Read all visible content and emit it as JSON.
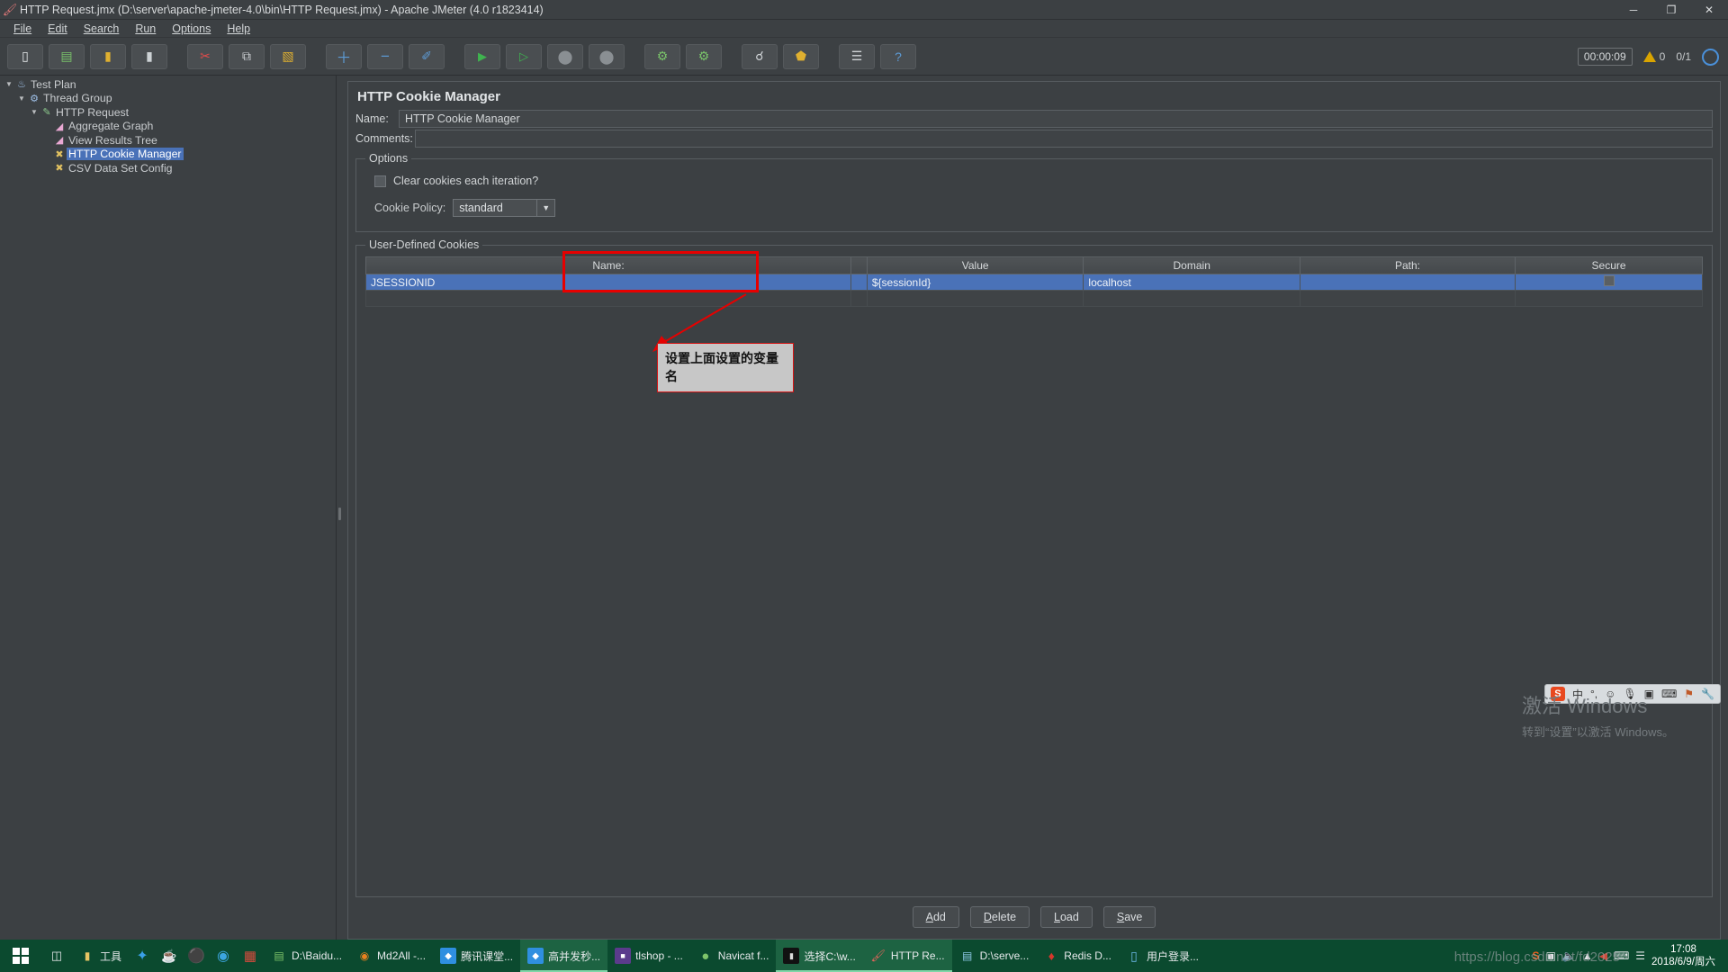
{
  "window": {
    "title": "HTTP Request.jmx (D:\\server\\apache-jmeter-4.0\\bin\\HTTP Request.jmx) - Apache JMeter (4.0 r1823414)",
    "app_icon": "jmeter-icon",
    "minimize": "─",
    "maximize": "❐",
    "close": "✕"
  },
  "menu": {
    "items": [
      {
        "label": "File"
      },
      {
        "label": "Edit"
      },
      {
        "label": "Search"
      },
      {
        "label": "Run"
      },
      {
        "label": "Options"
      },
      {
        "label": "Help"
      }
    ]
  },
  "toolbar": {
    "buttons": [
      {
        "name": "new-button",
        "glyph": "▭"
      },
      {
        "name": "templates-button",
        "glyph": "▤"
      },
      {
        "name": "open-button",
        "glyph": "▰"
      },
      {
        "name": "save-button",
        "glyph": "▮"
      },
      {
        "name": "cut-button",
        "glyph": "✂"
      },
      {
        "name": "copy-button",
        "glyph": "⧉"
      },
      {
        "name": "paste-button",
        "glyph": "▧"
      },
      {
        "name": "expand-all-button",
        "glyph": "＋"
      },
      {
        "name": "collapse-all-button",
        "glyph": "−"
      },
      {
        "name": "toggle-button",
        "glyph": "✐"
      },
      {
        "name": "start-button",
        "glyph": "▶"
      },
      {
        "name": "start-no-pauses-button",
        "glyph": "▷"
      },
      {
        "name": "stop-button",
        "glyph": "⬤"
      },
      {
        "name": "shutdown-button",
        "glyph": "⬤"
      },
      {
        "name": "clear-button",
        "glyph": "⌧"
      },
      {
        "name": "clear-all-button",
        "glyph": "⌧"
      },
      {
        "name": "search-button",
        "glyph": "☿"
      },
      {
        "name": "reset-search-button",
        "glyph": "⬟"
      },
      {
        "name": "function-helper-button",
        "glyph": "☰"
      },
      {
        "name": "help-button",
        "glyph": "?"
      }
    ],
    "timer": "00:00:09",
    "warning_count": "0",
    "thread_ratio": "0/1",
    "globe_icon": "globe-icon"
  },
  "tree": {
    "nodes": [
      {
        "label": "Test Plan",
        "indent": 0,
        "icon": "test-plan-icon",
        "arrow": "▼",
        "selected": false
      },
      {
        "label": "Thread Group",
        "indent": 1,
        "icon": "thread-group-icon",
        "arrow": "▼",
        "selected": false
      },
      {
        "label": "HTTP Request",
        "indent": 2,
        "icon": "http-request-icon",
        "arrow": "▼",
        "selected": false
      },
      {
        "label": "Aggregate Graph",
        "indent": 3,
        "icon": "listener-icon",
        "arrow": "",
        "selected": false
      },
      {
        "label": "View Results Tree",
        "indent": 3,
        "icon": "listener-icon",
        "arrow": "",
        "selected": false
      },
      {
        "label": "HTTP Cookie Manager",
        "indent": 3,
        "icon": "config-icon",
        "arrow": "",
        "selected": true
      },
      {
        "label": "CSV Data Set Config",
        "indent": 3,
        "icon": "config-icon",
        "arrow": "",
        "selected": false
      }
    ]
  },
  "panel": {
    "title": "HTTP Cookie Manager",
    "name_label": "Name:",
    "name_value": "HTTP Cookie Manager",
    "comments_label": "Comments:",
    "comments_value": "",
    "options_group_title": "Options",
    "clear_cookies_label": "Clear cookies each iteration?",
    "clear_cookies_checked": false,
    "cookie_policy_label": "Cookie Policy:",
    "cookie_policy_value": "standard",
    "cookie_policy_arrow": "▼",
    "cookies_group_title": "User-Defined Cookies",
    "table": {
      "columns": [
        "Name:",
        "Value",
        "Domain",
        "Path:",
        "Secure"
      ],
      "rows": [
        {
          "name": "JSESSIONID",
          "value": "${sessionId}",
          "domain": "localhost",
          "path": "",
          "secure": false,
          "selected": true
        }
      ],
      "empty_rows": 1
    },
    "buttons": [
      {
        "name": "add-button",
        "accel": "A",
        "rest": "dd"
      },
      {
        "name": "delete-button",
        "accel": "D",
        "rest": "elete"
      },
      {
        "name": "load-button",
        "accel": "L",
        "rest": "oad"
      },
      {
        "name": "save-button",
        "accel": "S",
        "rest": "ave"
      }
    ]
  },
  "annotation": {
    "text": "设置上面设置的变量名",
    "highlight_color": "#e60000"
  },
  "watermark": {
    "line1": "激活 Windows",
    "line2": "转到“设置”以激活 Windows。"
  },
  "ime": {
    "logo": "S",
    "mode": "中",
    "items": [
      "°,",
      "☺",
      "⬤",
      "▤",
      "⌨",
      "⚑",
      "🔧"
    ]
  },
  "taskbar": {
    "start_icon": "windows-logo-icon",
    "task_view_icon": "task-view-icon",
    "quick_items": [
      {
        "name": "folder-tools",
        "label": "工具",
        "icon": "folder-icon"
      },
      {
        "name": "quick-launch-1",
        "icon": "blue-star-icon"
      },
      {
        "name": "quick-launch-2",
        "icon": "coffee-icon"
      },
      {
        "name": "quick-launch-3",
        "icon": "dark-disc-icon"
      },
      {
        "name": "quick-launch-4",
        "icon": "opera-icon"
      },
      {
        "name": "quick-launch-5",
        "icon": "red-app-icon"
      }
    ],
    "tasks": [
      {
        "label": "D:\\Baidu...",
        "icon": "explorer-icon",
        "active": false
      },
      {
        "label": "Md2All -...",
        "icon": "firefox-icon",
        "active": false
      },
      {
        "label": "腾讯课堂...",
        "icon": "blue-diamond-icon",
        "active": false
      },
      {
        "label": "高并发秒...",
        "icon": "blue-diamond-icon",
        "active": true
      },
      {
        "label": "tlshop - ...",
        "icon": "purple-app-icon",
        "active": false
      },
      {
        "label": "Navicat f...",
        "icon": "navicat-icon",
        "active": false
      },
      {
        "label": "选择C:\\w...",
        "icon": "cmd-icon",
        "active": true
      },
      {
        "label": "HTTP Re...",
        "icon": "jmeter-icon",
        "active": true
      },
      {
        "label": "D:\\serve...",
        "icon": "explorer-icon",
        "active": false
      },
      {
        "label": "Redis D...",
        "icon": "redis-icon",
        "active": false
      },
      {
        "label": "用户登录...",
        "icon": "blue-phone-icon",
        "active": false
      }
    ],
    "tray": [
      "S",
      "▤",
      "♠",
      "▲",
      "◀",
      "⌨"
    ],
    "clock_time": "17:08",
    "clock_date": "2018/6/9/周六",
    "csdn": "https://blog.csdn.net/fd2025"
  }
}
